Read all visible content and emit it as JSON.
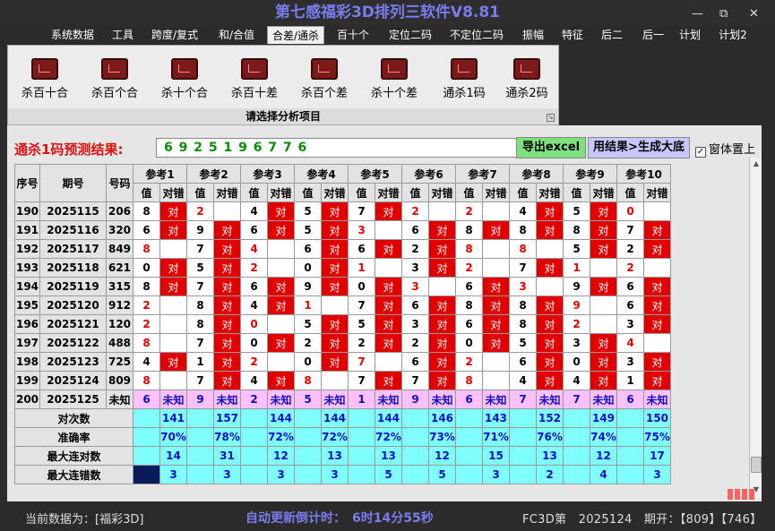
{
  "title": "第七感福彩3D排列三软件V8.81",
  "window_controls": {
    "minimize": "—",
    "restore": "⧉",
    "close": "✕"
  },
  "menu": [
    "系统数据",
    "工具",
    "跨度/复式",
    "和/合值",
    "合差/通杀",
    "百十个",
    "定位二码",
    "不定位二码",
    "振幅",
    "特征",
    "后二",
    "后一",
    "计划",
    "计划2"
  ],
  "menu_active": 4,
  "ribbon": {
    "buttons": [
      "杀百十合",
      "杀百个合",
      "杀十个合",
      "杀百十差",
      "杀百个差",
      "杀十个差",
      "通杀1码",
      "通杀2码"
    ],
    "caption": "请选择分析项目"
  },
  "prediction": {
    "label": "通杀1码预测结果:",
    "value": "6 9 2 5 1 9 6 7 7 6",
    "export_label": "导出excel",
    "generate_label": "用结果>生成大底",
    "topmost_label": "窗体置上",
    "topmost_checked": "✓"
  },
  "table": {
    "headers": {
      "seq": "序号",
      "period": "期号",
      "number": "号码",
      "value": "值",
      "result": "对错"
    },
    "refs": [
      "参考1",
      "参考2",
      "参考3",
      "参考4",
      "参考5",
      "参考6",
      "参考7",
      "参考8",
      "参考9",
      "参考10"
    ],
    "rows": [
      {
        "seq": "190",
        "period": "2025115",
        "num": "206",
        "vals": [
          "8",
          "2",
          "4",
          "5",
          "7",
          "2",
          "2",
          "4",
          "5",
          "0"
        ],
        "hit": [
          1,
          0,
          1,
          1,
          1,
          0,
          0,
          1,
          1,
          0
        ]
      },
      {
        "seq": "191",
        "period": "2025116",
        "num": "320",
        "vals": [
          "6",
          "9",
          "6",
          "5",
          "3",
          "6",
          "8",
          "8",
          "8",
          "7"
        ],
        "hit": [
          1,
          1,
          1,
          1,
          0,
          1,
          1,
          1,
          1,
          1
        ]
      },
      {
        "seq": "192",
        "period": "2025117",
        "num": "849",
        "vals": [
          "8",
          "7",
          "4",
          "6",
          "6",
          "2",
          "8",
          "8",
          "5",
          "2"
        ],
        "hit": [
          0,
          1,
          0,
          1,
          1,
          1,
          0,
          0,
          1,
          1
        ]
      },
      {
        "seq": "193",
        "period": "2025118",
        "num": "621",
        "vals": [
          "0",
          "5",
          "2",
          "0",
          "1",
          "3",
          "2",
          "7",
          "1",
          "2"
        ],
        "hit": [
          1,
          1,
          0,
          1,
          0,
          1,
          0,
          1,
          0,
          0
        ]
      },
      {
        "seq": "194",
        "period": "2025119",
        "num": "315",
        "vals": [
          "8",
          "7",
          "6",
          "9",
          "0",
          "3",
          "6",
          "3",
          "9",
          "6"
        ],
        "hit": [
          1,
          1,
          1,
          1,
          1,
          0,
          1,
          0,
          1,
          1
        ]
      },
      {
        "seq": "195",
        "period": "2025120",
        "num": "912",
        "vals": [
          "2",
          "8",
          "4",
          "1",
          "7",
          "6",
          "8",
          "8",
          "9",
          "6"
        ],
        "hit": [
          0,
          1,
          1,
          0,
          1,
          1,
          1,
          1,
          0,
          1
        ]
      },
      {
        "seq": "196",
        "period": "2025121",
        "num": "120",
        "vals": [
          "2",
          "8",
          "0",
          "5",
          "5",
          "3",
          "6",
          "8",
          "2",
          "3"
        ],
        "hit": [
          0,
          1,
          0,
          1,
          1,
          1,
          1,
          1,
          0,
          1
        ]
      },
      {
        "seq": "197",
        "period": "2025122",
        "num": "488",
        "vals": [
          "8",
          "7",
          "0",
          "2",
          "2",
          "2",
          "0",
          "5",
          "3",
          "4"
        ],
        "hit": [
          0,
          1,
          1,
          1,
          1,
          1,
          1,
          1,
          1,
          0
        ]
      },
      {
        "seq": "198",
        "period": "2025123",
        "num": "725",
        "vals": [
          "4",
          "1",
          "2",
          "0",
          "7",
          "6",
          "2",
          "6",
          "0",
          "3"
        ],
        "hit": [
          1,
          1,
          0,
          1,
          0,
          1,
          0,
          1,
          1,
          1
        ]
      },
      {
        "seq": "199",
        "period": "2025124",
        "num": "809",
        "vals": [
          "8",
          "7",
          "4",
          "8",
          "7",
          "7",
          "8",
          "4",
          "4",
          "1"
        ],
        "hit": [
          0,
          1,
          1,
          0,
          1,
          1,
          0,
          1,
          1,
          1
        ]
      }
    ],
    "pending": {
      "seq": "200",
      "period": "2025125",
      "num": "未知",
      "vals": [
        "6",
        "9",
        "2",
        "5",
        "1",
        "9",
        "6",
        "7",
        "7",
        "6"
      ],
      "label": "未知"
    },
    "hit_label": "对",
    "stats": [
      {
        "label": "对次数",
        "vals": [
          "141",
          "157",
          "144",
          "144",
          "144",
          "146",
          "143",
          "152",
          "149",
          "150"
        ]
      },
      {
        "label": "准确率",
        "vals": [
          "70%",
          "78%",
          "72%",
          "72%",
          "72%",
          "73%",
          "71%",
          "76%",
          "74%",
          "75%"
        ]
      },
      {
        "label": "最大连对数",
        "vals": [
          "14",
          "31",
          "12",
          "13",
          "13",
          "12",
          "15",
          "13",
          "12",
          "17"
        ]
      },
      {
        "label": "最大连错数",
        "vals": [
          "3",
          "3",
          "3",
          "3",
          "5",
          "5",
          "3",
          "2",
          "4",
          "3"
        ]
      }
    ]
  },
  "status": {
    "left": "当前数据为：[福彩3D]",
    "countdown": "自动更新倒计时：　6时14分55秒",
    "right": "FC3D第　2025124　期开：【809】【746】"
  }
}
